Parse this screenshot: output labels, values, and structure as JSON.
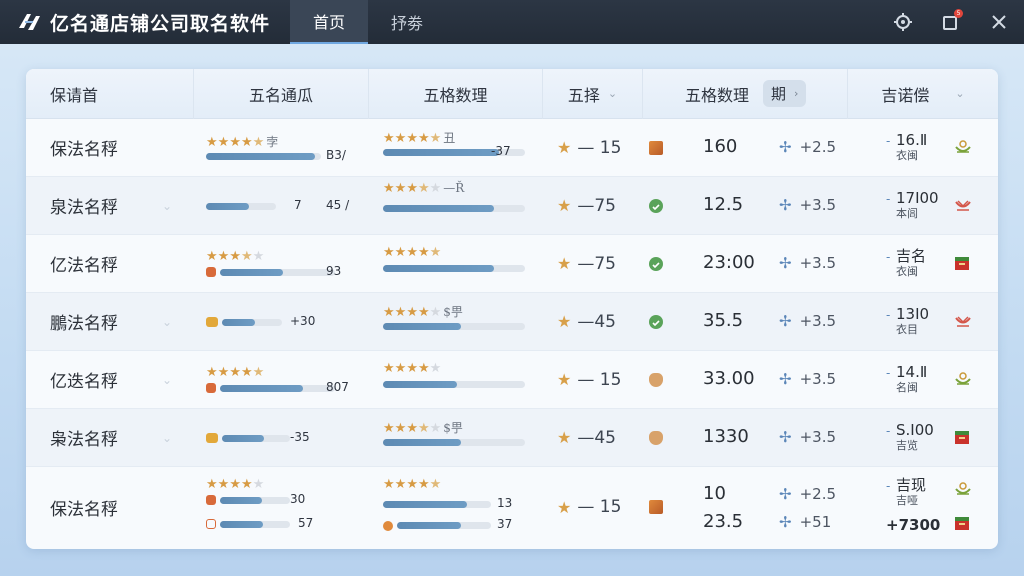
{
  "app": {
    "title": "亿名通店铺公司取名软件"
  },
  "tabs": [
    {
      "label": "首页",
      "active": true
    },
    {
      "label": "抒劵",
      "active": false
    }
  ],
  "window": {
    "notification_count": "5"
  },
  "table": {
    "headers": {
      "col1": "保请首",
      "col2": "五名通瓜",
      "col3": "五格数理",
      "col4": "五择",
      "col5": "五格数理",
      "col5_pill": "期",
      "col6": "吉诺偿"
    },
    "rows": [
      {
        "name": "保法名稃",
        "rating_stars": 4.5,
        "rating_note": "孛",
        "bar_fill": 0.95,
        "bar_val": "B3/",
        "rating2_stars": 4.5,
        "rating2_note": "丑",
        "bar2_fill": 0.82,
        "bar2_val": "-37",
        "change": "— 15",
        "status": "square-orange",
        "value": "160",
        "delta": "+2.5",
        "result": "16.Ⅱ",
        "result_sub": "衣闽",
        "result_icon": "bowl-green"
      },
      {
        "name": "泉法名稃",
        "rating_stars": 0,
        "rating_note": "",
        "bar_fill": 0.62,
        "bar_val": "45 /",
        "bar_pre": "7",
        "rating2_stars": 3.5,
        "rating2_note": "—Ř",
        "bar2_fill": 0.78,
        "bar2_val": "",
        "change": "—75",
        "status": "circle-green",
        "value": "12.5",
        "delta": "+3.5",
        "result": "17Ⅰ00",
        "result_sub": "本闾",
        "result_icon": "bowl-red"
      },
      {
        "name": "亿法名稃",
        "rating_stars": 3.5,
        "rating_note": "",
        "bar_fill": 0.55,
        "bar_val": "93",
        "rating2_stars": 4.5,
        "rating2_note": "",
        "bar2_fill": 0.78,
        "bar2_val": "",
        "change": "—75",
        "status": "circle-green",
        "value": "23:00",
        "delta": "+3.5",
        "result": "吉名",
        "result_sub": "衣闽",
        "result_icon": "box-red"
      },
      {
        "name": "鵬法名稃",
        "rating_stars": 0,
        "rating_note": "",
        "bar_fill": 0.55,
        "bar_val": "+30",
        "rating2_stars": 4,
        "rating2_note": "$甼",
        "bar2_fill": 0.55,
        "bar2_val": "",
        "change": "—45",
        "status": "circle-green",
        "value": "35.5",
        "delta": "+3.5",
        "result": "13Ⅰ0",
        "result_sub": "衣目",
        "result_icon": "bowl-red"
      },
      {
        "name": "亿迭名稃",
        "rating_stars": 4.5,
        "rating_note": "",
        "bar_fill": 0.72,
        "bar_val": "807",
        "rating2_stars": 4,
        "rating2_note": "",
        "bar2_fill": 0.52,
        "bar2_val": "",
        "change": "— 15",
        "status": "shield-tan",
        "value": "33.00",
        "delta": "+3.5",
        "result": "14.Ⅱ",
        "result_sub": "名闽",
        "result_icon": "bowl-green"
      },
      {
        "name": "枭法名稃",
        "rating_stars": 0,
        "rating_note": "",
        "bar_fill": 0.62,
        "bar_val": "-35",
        "rating2_stars": 3.5,
        "rating2_note": "$甼",
        "bar2_fill": 0.55,
        "bar2_val": "",
        "change": "—45",
        "status": "shield-tan",
        "value": "1330",
        "delta": "+3.5",
        "result": "S.Ⅰ00",
        "result_sub": "吉览",
        "result_icon": "box-red"
      },
      {
        "name": "保法名稃",
        "rating_stars": 4,
        "rating_note": "",
        "bar_fill": 0.6,
        "bar_val": "30",
        "bar_b_fill": 0.62,
        "bar_b_val": "57",
        "rating2_stars": 4.5,
        "rating2_note": "",
        "bar2_fill": 0.78,
        "bar2_val": "13",
        "bar2_b_fill": 0.68,
        "bar2_b_val": "37",
        "change": "— 15",
        "status": "square-orange",
        "value": "10",
        "value_b": "23.5",
        "delta": "+2.5",
        "delta_b": "+51",
        "result": "吉现",
        "result_sub": "吉哑",
        "result_b": "+7300",
        "result_icon": "bowl-green",
        "result_icon_b": "box-red"
      }
    ]
  },
  "colors": {
    "titlebar": "#232c38",
    "star": "#d79b44",
    "bar": "#5d8ab3",
    "accent": "#5b86b8"
  }
}
